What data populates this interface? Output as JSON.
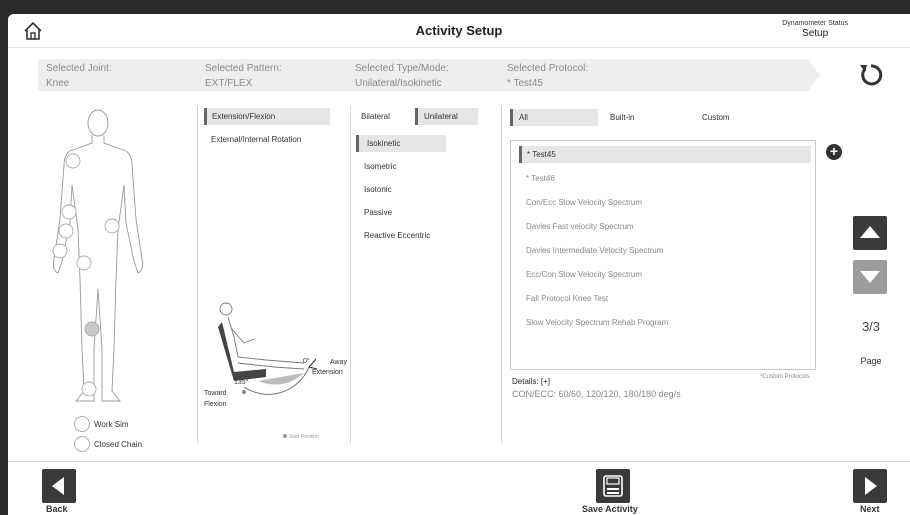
{
  "header": {
    "title": "Activity Setup",
    "dynamometer_label": "Dynamometer Status",
    "dynamometer_value": "Setup"
  },
  "summary": {
    "joint_label": "Selected Joint:",
    "joint_value": "Knee",
    "pattern_label": "Selected Pattern:",
    "pattern_value": "EXT/FLEX",
    "mode_label": "Selected Type/Mode:",
    "mode_value": "Unilateral/Isokinetic",
    "protocol_label": "Selected Protocol:",
    "protocol_value": "* Test45"
  },
  "body_options": {
    "work_sim": "Work Sim",
    "closed_chain": "Closed Chain"
  },
  "patterns": [
    "Extension/Flexion",
    "External/Internal Rotation"
  ],
  "mode_tabs": [
    "Bilateral",
    "Unilateral"
  ],
  "modes": [
    "Isokinetic",
    "Isometric",
    "Isotonic",
    "Passive",
    "Reactive Eccentric"
  ],
  "chair": {
    "angle_zero": "0°",
    "angle_max": "135°",
    "away": "Away",
    "extension": "Extension",
    "toward": "Toward",
    "flexion": "Flexion",
    "start_position": "Start Position"
  },
  "filters": [
    "All",
    "Built-in",
    "Custom"
  ],
  "protocols": [
    "* Test45",
    "* Test46",
    "Con/Ecc Slow Velocity Spectrum",
    "Davies Fast velocity Spectrum",
    "Davies Intermediate Velocity Spectrum",
    "Ecc/Con Slow Velocity Spectrum",
    "Fall Protocol Knee Test",
    "Slow Velocity Spectrum Rehab Program"
  ],
  "custom_note": "*Custom Protocols",
  "details": {
    "label": "Details:  [+]",
    "value": "CON/ECC: 60/60, 120/120, 180/180 deg/s"
  },
  "pagination": {
    "page_num": "3/3",
    "page_label": "Page"
  },
  "footer": {
    "back": "Back",
    "save": "Save Activity",
    "next": "Next"
  }
}
